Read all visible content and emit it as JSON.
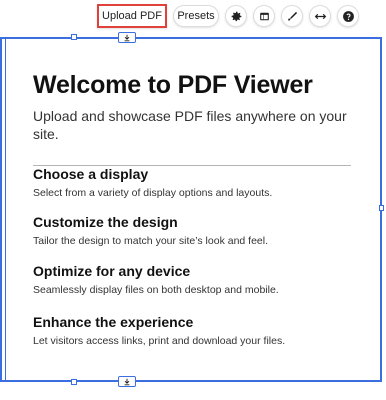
{
  "toolbar": {
    "upload_label": "Upload PDF",
    "presets_label": "Presets",
    "icons": [
      "gear-icon",
      "layout-icon",
      "pen-icon",
      "stretch-icon",
      "help-icon"
    ]
  },
  "hero": {
    "title": "Welcome to PDF Viewer",
    "subtitle": "Upload and showcase PDF files anywhere on your site."
  },
  "features": [
    {
      "title": "Choose a display",
      "desc": "Select from a variety of display options and layouts."
    },
    {
      "title": "Customize the design",
      "desc": "Tailor the design to match your site’s look and feel."
    },
    {
      "title": "Optimize for any device",
      "desc": "Seamlessly display files on both desktop and mobile."
    },
    {
      "title": "Enhance the experience",
      "desc": "Let visitors access links, print and download your files."
    }
  ],
  "colors": {
    "selection": "#3b6fe0",
    "highlight": "#e0413a"
  }
}
